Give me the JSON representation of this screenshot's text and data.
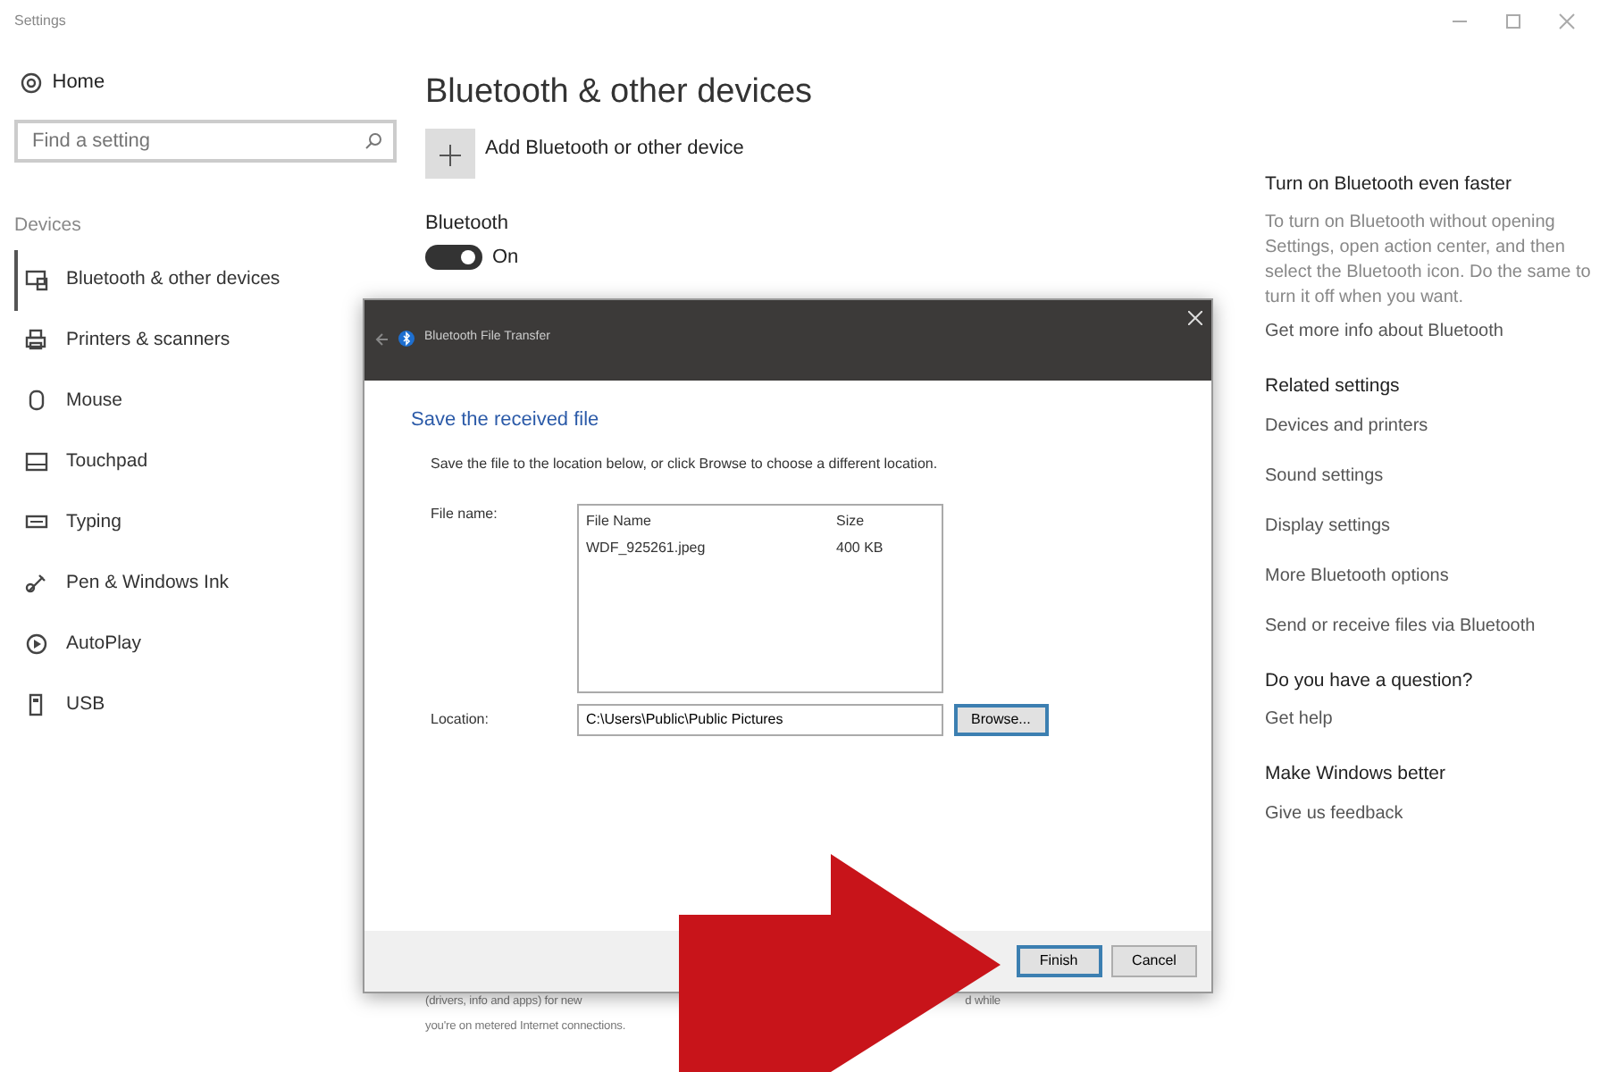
{
  "window": {
    "title": "Settings"
  },
  "sidebar": {
    "home": "Home",
    "search": {
      "placeholder": "Find a setting"
    },
    "section": "Devices",
    "items": [
      {
        "label": "Bluetooth & other devices",
        "selected": true
      },
      {
        "label": "Printers & scanners",
        "selected": false
      },
      {
        "label": "Mouse",
        "selected": false
      },
      {
        "label": "Touchpad",
        "selected": false
      },
      {
        "label": "Typing",
        "selected": false
      },
      {
        "label": "Pen & Windows Ink",
        "selected": false
      },
      {
        "label": "AutoPlay",
        "selected": false
      },
      {
        "label": "USB",
        "selected": false
      }
    ]
  },
  "main": {
    "title": "Bluetooth & other devices",
    "add_button": "Add Bluetooth or other device",
    "bluetooth_label": "Bluetooth",
    "toggle": {
      "on": true,
      "label": "On"
    },
    "note_lines": [
      "(drivers, info and apps) for new",
      "d while",
      "you're on metered Internet connections."
    ]
  },
  "aside": {
    "groups": [
      {
        "heading": "Turn on Bluetooth even faster",
        "text": "To turn on Bluetooth without opening Settings, open action center, and then select the Bluetooth icon. Do the same to turn it off when you want.",
        "links": [
          "Get more info about Bluetooth"
        ]
      },
      {
        "heading": "Related settings",
        "links": [
          "Devices and printers",
          "Sound settings",
          "Display settings",
          "More Bluetooth options",
          "Send or receive files via Bluetooth"
        ]
      },
      {
        "heading": "Do you have a question?",
        "links": [
          "Get help"
        ]
      },
      {
        "heading": "Make Windows better",
        "links": [
          "Give us feedback"
        ]
      }
    ]
  },
  "dialog": {
    "title": "Bluetooth File Transfer",
    "heading": "Save the received file",
    "instruction": "Save the file to the location below, or click Browse to choose a different location.",
    "file_label": "File name:",
    "columns": [
      "File Name",
      "Size"
    ],
    "rows": [
      [
        "WDF_925261.jpeg",
        "400 KB"
      ]
    ],
    "location_label": "Location:",
    "location": "C:\\Users\\Public\\Public Pictures",
    "browse": "Browse...",
    "buttons": [
      "Finish",
      "Cancel"
    ]
  }
}
